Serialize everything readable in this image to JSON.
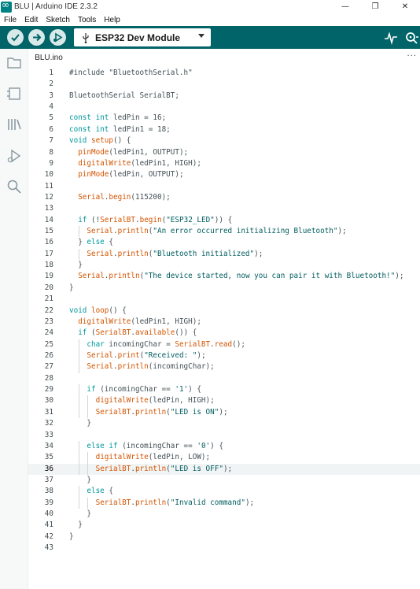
{
  "window": {
    "title": "BLU | Arduino IDE 2.3.2",
    "minimize": "—",
    "restore": "❐",
    "close": "✕"
  },
  "menu": [
    "File",
    "Edit",
    "Sketch",
    "Tools",
    "Help"
  ],
  "toolbar": {
    "verify_icon": "check-icon",
    "upload_icon": "arrow-right-icon",
    "debug_icon": "debug-icon",
    "board": "ESP32 Dev Module",
    "serial_plotter_icon": "pulse-icon",
    "serial_monitor_icon": "magnifier-dots-icon"
  },
  "sidebar": [
    "folder-icon",
    "board-icon",
    "library-icon",
    "debug-icon",
    "search-icon"
  ],
  "tab": {
    "name": "BLU.ino",
    "more": "···"
  },
  "editor": {
    "current_line": 36,
    "lines": [
      [
        [
          "pp",
          "#include \"BluetoothSerial.h\""
        ]
      ],
      [],
      [
        [
          "",
          "BluetoothSerial SerialBT;"
        ]
      ],
      [],
      [
        [
          "kw",
          "const"
        ],
        [
          "",
          " "
        ],
        [
          "kw",
          "int"
        ],
        [
          "",
          " ledPin = 16;"
        ]
      ],
      [
        [
          "kw",
          "const"
        ],
        [
          "",
          " "
        ],
        [
          "kw",
          "int"
        ],
        [
          "",
          " ledPin1 = 18;"
        ]
      ],
      [
        [
          "kw",
          "void"
        ],
        [
          "",
          " "
        ],
        [
          "fn",
          "setup"
        ],
        [
          "",
          "() {"
        ]
      ],
      [
        [
          "",
          "  "
        ],
        [
          "fn",
          "pinMode"
        ],
        [
          "",
          "(ledPin1, OUTPUT);"
        ]
      ],
      [
        [
          "",
          "  "
        ],
        [
          "fn",
          "digitalWrite"
        ],
        [
          "",
          "(ledPin1, HIGH);"
        ]
      ],
      [
        [
          "",
          "  "
        ],
        [
          "fn",
          "pinMode"
        ],
        [
          "",
          "(ledPin, OUTPUT);"
        ]
      ],
      [],
      [
        [
          "",
          "  "
        ],
        [
          "fn",
          "Serial"
        ],
        [
          "",
          "."
        ],
        [
          "fn",
          "begin"
        ],
        [
          "",
          "(115200);"
        ]
      ],
      [],
      [
        [
          "",
          "  "
        ],
        [
          "kw",
          "if"
        ],
        [
          "",
          " (!"
        ],
        [
          "fn",
          "SerialBT"
        ],
        [
          "",
          "."
        ],
        [
          "fn",
          "begin"
        ],
        [
          "",
          "("
        ],
        [
          "str",
          "\"ESP32_LED\""
        ],
        [
          "",
          ")) {"
        ]
      ],
      [
        [
          "",
          "    "
        ],
        [
          "fn",
          "Serial"
        ],
        [
          "",
          "."
        ],
        [
          "fn",
          "println"
        ],
        [
          "",
          "("
        ],
        [
          "str",
          "\"An error occurred initializing Bluetooth\""
        ],
        [
          "",
          ");"
        ]
      ],
      [
        [
          "",
          "  } "
        ],
        [
          "kw",
          "else"
        ],
        [
          "",
          " {"
        ]
      ],
      [
        [
          "",
          "    "
        ],
        [
          "fn",
          "Serial"
        ],
        [
          "",
          "."
        ],
        [
          "fn",
          "println"
        ],
        [
          "",
          "("
        ],
        [
          "str",
          "\"Bluetooth initialized\""
        ],
        [
          "",
          ");"
        ]
      ],
      [
        [
          "",
          "  }"
        ]
      ],
      [
        [
          "",
          "  "
        ],
        [
          "fn",
          "Serial"
        ],
        [
          "",
          "."
        ],
        [
          "fn",
          "println"
        ],
        [
          "",
          "("
        ],
        [
          "str",
          "\"The device started, now you can pair it with Bluetooth!\""
        ],
        [
          "",
          ");"
        ]
      ],
      [
        [
          "",
          "}"
        ]
      ],
      [],
      [
        [
          "kw",
          "void"
        ],
        [
          "",
          " "
        ],
        [
          "fn",
          "loop"
        ],
        [
          "",
          "() {"
        ]
      ],
      [
        [
          "",
          "  "
        ],
        [
          "fn",
          "digitalWrite"
        ],
        [
          "",
          "(ledPin1, HIGH);"
        ]
      ],
      [
        [
          "",
          "  "
        ],
        [
          "kw",
          "if"
        ],
        [
          "",
          " ("
        ],
        [
          "fn",
          "SerialBT"
        ],
        [
          "",
          "."
        ],
        [
          "fn",
          "available"
        ],
        [
          "",
          "()) {"
        ]
      ],
      [
        [
          "",
          "    "
        ],
        [
          "kw",
          "char"
        ],
        [
          "",
          " incomingChar = "
        ],
        [
          "fn",
          "SerialBT"
        ],
        [
          "",
          "."
        ],
        [
          "fn",
          "read"
        ],
        [
          "",
          "();"
        ]
      ],
      [
        [
          "",
          "    "
        ],
        [
          "fn",
          "Serial"
        ],
        [
          "",
          "."
        ],
        [
          "fn",
          "print"
        ],
        [
          "",
          "("
        ],
        [
          "str",
          "\"Received: \""
        ],
        [
          "",
          ");"
        ]
      ],
      [
        [
          "",
          "    "
        ],
        [
          "fn",
          "Serial"
        ],
        [
          "",
          "."
        ],
        [
          "fn",
          "println"
        ],
        [
          "",
          "(incomingChar);"
        ]
      ],
      [],
      [
        [
          "",
          "    "
        ],
        [
          "kw",
          "if"
        ],
        [
          "",
          " (incomingChar == "
        ],
        [
          "str",
          "'1'"
        ],
        [
          "",
          ") {"
        ]
      ],
      [
        [
          "",
          "      "
        ],
        [
          "fn",
          "digitalWrite"
        ],
        [
          "",
          "(ledPin, HIGH);"
        ]
      ],
      [
        [
          "",
          "      "
        ],
        [
          "fn",
          "SerialBT"
        ],
        [
          "",
          "."
        ],
        [
          "fn",
          "println"
        ],
        [
          "",
          "("
        ],
        [
          "str",
          "\"LED is ON\""
        ],
        [
          "",
          ");"
        ]
      ],
      [
        [
          "",
          "    }"
        ]
      ],
      [],
      [
        [
          "",
          "    "
        ],
        [
          "kw",
          "else"
        ],
        [
          "",
          " "
        ],
        [
          "kw",
          "if"
        ],
        [
          "",
          " (incomingChar == "
        ],
        [
          "str",
          "'0'"
        ],
        [
          "",
          ") {"
        ]
      ],
      [
        [
          "",
          "      "
        ],
        [
          "fn",
          "digitalWrite"
        ],
        [
          "",
          "(ledPin, LOW);"
        ]
      ],
      [
        [
          "",
          "      "
        ],
        [
          "fn",
          "SerialBT"
        ],
        [
          "",
          "."
        ],
        [
          "fn",
          "println"
        ],
        [
          "",
          "("
        ],
        [
          "str",
          "\"LED is OFF\""
        ],
        [
          "",
          ");"
        ]
      ],
      [
        [
          "",
          "    }"
        ]
      ],
      [
        [
          "",
          "    "
        ],
        [
          "kw",
          "else"
        ],
        [
          "",
          " {"
        ]
      ],
      [
        [
          "",
          "      "
        ],
        [
          "fn",
          "SerialBT"
        ],
        [
          "",
          "."
        ],
        [
          "fn",
          "println"
        ],
        [
          "",
          "("
        ],
        [
          "str",
          "\"Invalid command\""
        ],
        [
          "",
          ");"
        ]
      ],
      [
        [
          "",
          "    }"
        ]
      ],
      [
        [
          "",
          "  }"
        ]
      ],
      [
        [
          "",
          "}"
        ]
      ],
      []
    ]
  }
}
